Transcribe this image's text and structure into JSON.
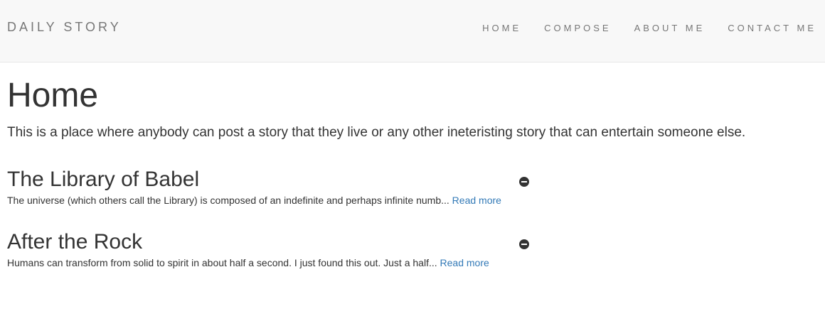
{
  "navbar": {
    "brand": "DAILY STORY",
    "links": [
      {
        "label": "HOME"
      },
      {
        "label": "COMPOSE"
      },
      {
        "label": "ABOUT ME"
      },
      {
        "label": "CONTACT ME"
      }
    ]
  },
  "main": {
    "title": "Home",
    "intro": "This is a place where anybody can post a story that they live or any other ineteristing story that can entertain someone else.",
    "posts": [
      {
        "title": "The Library of Babel",
        "excerpt": "The universe (which others call the Library) is composed of an indefinite and perhaps infinite numb...",
        "read_more": "Read more",
        "remove_icon": "minus-circle-icon"
      },
      {
        "title": "After the Rock",
        "excerpt": "Humans can transform from solid to spirit in about half a second. I just found this out. Just a half...",
        "read_more": "Read more",
        "remove_icon": "minus-circle-icon"
      }
    ]
  },
  "colors": {
    "navbar_bg": "#f8f8f8",
    "nav_text": "#777777",
    "body_text": "#333333",
    "link": "#337ab7"
  }
}
